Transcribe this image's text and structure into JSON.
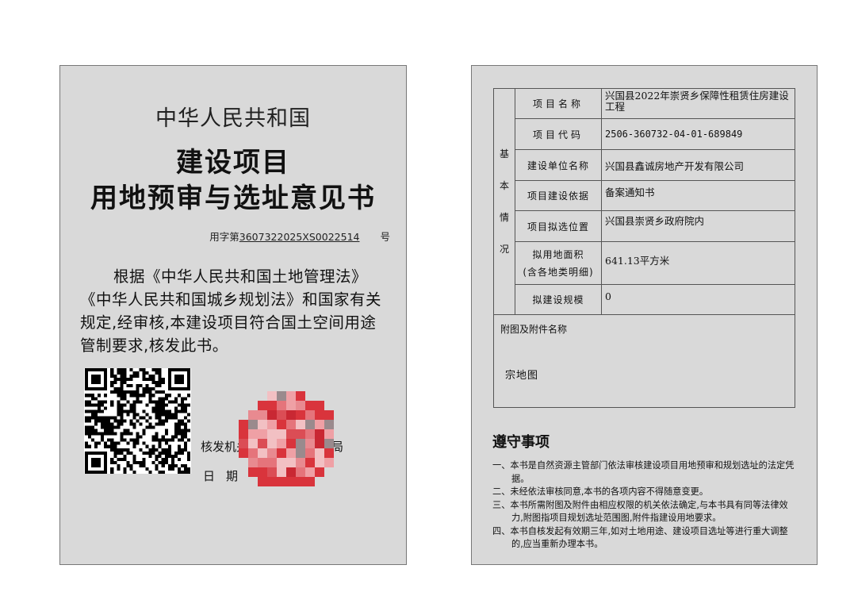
{
  "left_page": {
    "country": "中华人民共和国",
    "title_line1": "建设项目",
    "title_line2": "用地预审与选址意见书",
    "doc_number": {
      "prefix": "用字第",
      "number": "3607322025XS0022514",
      "suffix": "号"
    },
    "statement": "根据《中华人民共和国土地管理法》《中华人民共和国城乡规划法》和国家有关规定,经审核,本建设项目符合国土空间用途管制要求,核发此书。",
    "issuer_label": "核发机关",
    "issuer_visible_fragment": "局",
    "date_label": "日期"
  },
  "right_page": {
    "section_label": "基本情况",
    "rows": [
      {
        "label": "项目名称",
        "value": "兴国县2022年崇贤乡保障性租赁住房建设工程"
      },
      {
        "label": "项目代码",
        "value": "2506-360732-04-01-689849"
      },
      {
        "label": "建设单位名称",
        "value": "兴国县鑫诚房地产开发有限公司"
      },
      {
        "label": "项目建设依据",
        "value": "备案通知书"
      },
      {
        "label": "项目拟选位置",
        "value": "兴国县崇贤乡政府院内"
      },
      {
        "label": "拟用地面积",
        "label_note": "(含各地类明细)",
        "value": "641.13平方米"
      },
      {
        "label": "拟建设规模",
        "value": "0"
      }
    ],
    "attachments_label": "附图及附件名称",
    "attachments": [
      "宗地图"
    ],
    "notice_title": "遵守事项",
    "notices": [
      "一、本书是自然资源主管部门依法审核建设项目用地预审和规划选址的法定凭据。",
      "二、未经依法审核同意,本书的各项内容不得随意变更。",
      "三、本书所需附图及附件由相应权限的机关依法确定,与本书具有同等法律效力,附图指项目规划选址范围图,附件指建设用地要求。",
      "四、本书自核发起有效期三年,如对土地用途、建设项目选址等进行重大调整的,应当重新办理本书。"
    ]
  },
  "colors": {
    "page_background": "#d9d9d9",
    "seal_red": "#d9343c"
  }
}
